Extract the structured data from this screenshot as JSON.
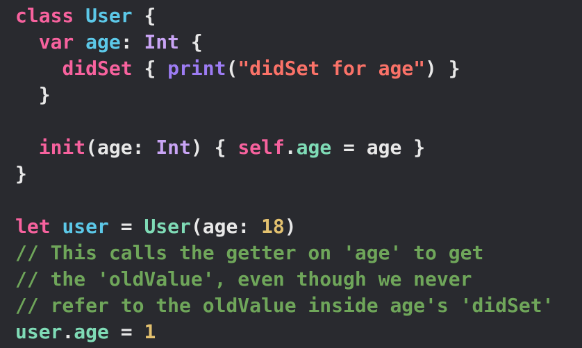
{
  "editor": {
    "language": "Swift",
    "background_color": "#292a2f",
    "theme": {
      "keyword_color": "#f7629e",
      "declaration_color": "#5cc8e8",
      "type_color": "#7fdbb6",
      "member_color": "#7fdbb6",
      "builtin_type_color": "#c9a4f5",
      "function_color": "#9d7cf4",
      "string_color": "#fa7268",
      "number_color": "#e3c16f",
      "comment_color": "#6fa65a",
      "plain_color": "#e8e8e8"
    },
    "lines": [
      {
        "index": 1,
        "text": "class User {",
        "tokens": [
          {
            "t": "class",
            "c": "keyword"
          },
          {
            "t": " ",
            "c": "plain"
          },
          {
            "t": "User",
            "c": "decl"
          },
          {
            "t": " {",
            "c": "plain"
          }
        ]
      },
      {
        "index": 2,
        "text": "  var age: Int {",
        "tokens": [
          {
            "t": "  ",
            "c": "plain"
          },
          {
            "t": "var",
            "c": "keyword"
          },
          {
            "t": " ",
            "c": "plain"
          },
          {
            "t": "age",
            "c": "decl"
          },
          {
            "t": ": ",
            "c": "plain"
          },
          {
            "t": "Int",
            "c": "builtin"
          },
          {
            "t": " {",
            "c": "plain"
          }
        ]
      },
      {
        "index": 3,
        "text": "    didSet { print(\"didSet for age\") }",
        "tokens": [
          {
            "t": "    ",
            "c": "plain"
          },
          {
            "t": "didSet",
            "c": "keyword"
          },
          {
            "t": " { ",
            "c": "plain"
          },
          {
            "t": "print",
            "c": "function"
          },
          {
            "t": "(",
            "c": "plain"
          },
          {
            "t": "\"didSet for age\"",
            "c": "string"
          },
          {
            "t": ") }",
            "c": "plain"
          }
        ]
      },
      {
        "index": 4,
        "text": "  }",
        "tokens": [
          {
            "t": "  }",
            "c": "plain"
          }
        ]
      },
      {
        "index": 5,
        "text": "",
        "tokens": []
      },
      {
        "index": 6,
        "text": "  init(age: Int) { self.age = age }",
        "tokens": [
          {
            "t": "  ",
            "c": "plain"
          },
          {
            "t": "init",
            "c": "keyword"
          },
          {
            "t": "(age: ",
            "c": "plain"
          },
          {
            "t": "Int",
            "c": "builtin"
          },
          {
            "t": ") { ",
            "c": "plain"
          },
          {
            "t": "self",
            "c": "keyword"
          },
          {
            "t": ".",
            "c": "plain"
          },
          {
            "t": "age",
            "c": "member"
          },
          {
            "t": " = age }",
            "c": "plain"
          }
        ]
      },
      {
        "index": 7,
        "text": "}",
        "tokens": [
          {
            "t": "}",
            "c": "plain"
          }
        ]
      },
      {
        "index": 8,
        "text": "",
        "tokens": []
      },
      {
        "index": 9,
        "text": "let user = User(age: 18)",
        "tokens": [
          {
            "t": "let",
            "c": "keyword"
          },
          {
            "t": " ",
            "c": "plain"
          },
          {
            "t": "user",
            "c": "decl"
          },
          {
            "t": " = ",
            "c": "plain"
          },
          {
            "t": "User",
            "c": "type"
          },
          {
            "t": "(age: ",
            "c": "plain"
          },
          {
            "t": "18",
            "c": "number"
          },
          {
            "t": ")",
            "c": "plain"
          }
        ]
      },
      {
        "index": 10,
        "text": "// This calls the getter on 'age' to get",
        "tokens": [
          {
            "t": "// This calls the getter on 'age' to get",
            "c": "comment"
          }
        ]
      },
      {
        "index": 11,
        "text": "// the 'oldValue', even though we never",
        "tokens": [
          {
            "t": "// the 'oldValue', even though we never",
            "c": "comment"
          }
        ]
      },
      {
        "index": 12,
        "text": "// refer to the oldValue inside age's 'didSet'",
        "tokens": [
          {
            "t": "// refer to the oldValue inside age's 'didSet'",
            "c": "comment"
          }
        ]
      },
      {
        "index": 13,
        "text": "user.age = 1",
        "tokens": [
          {
            "t": "user",
            "c": "member"
          },
          {
            "t": ".",
            "c": "plain"
          },
          {
            "t": "age",
            "c": "member"
          },
          {
            "t": " = ",
            "c": "plain"
          },
          {
            "t": "1",
            "c": "number"
          }
        ]
      }
    ]
  }
}
